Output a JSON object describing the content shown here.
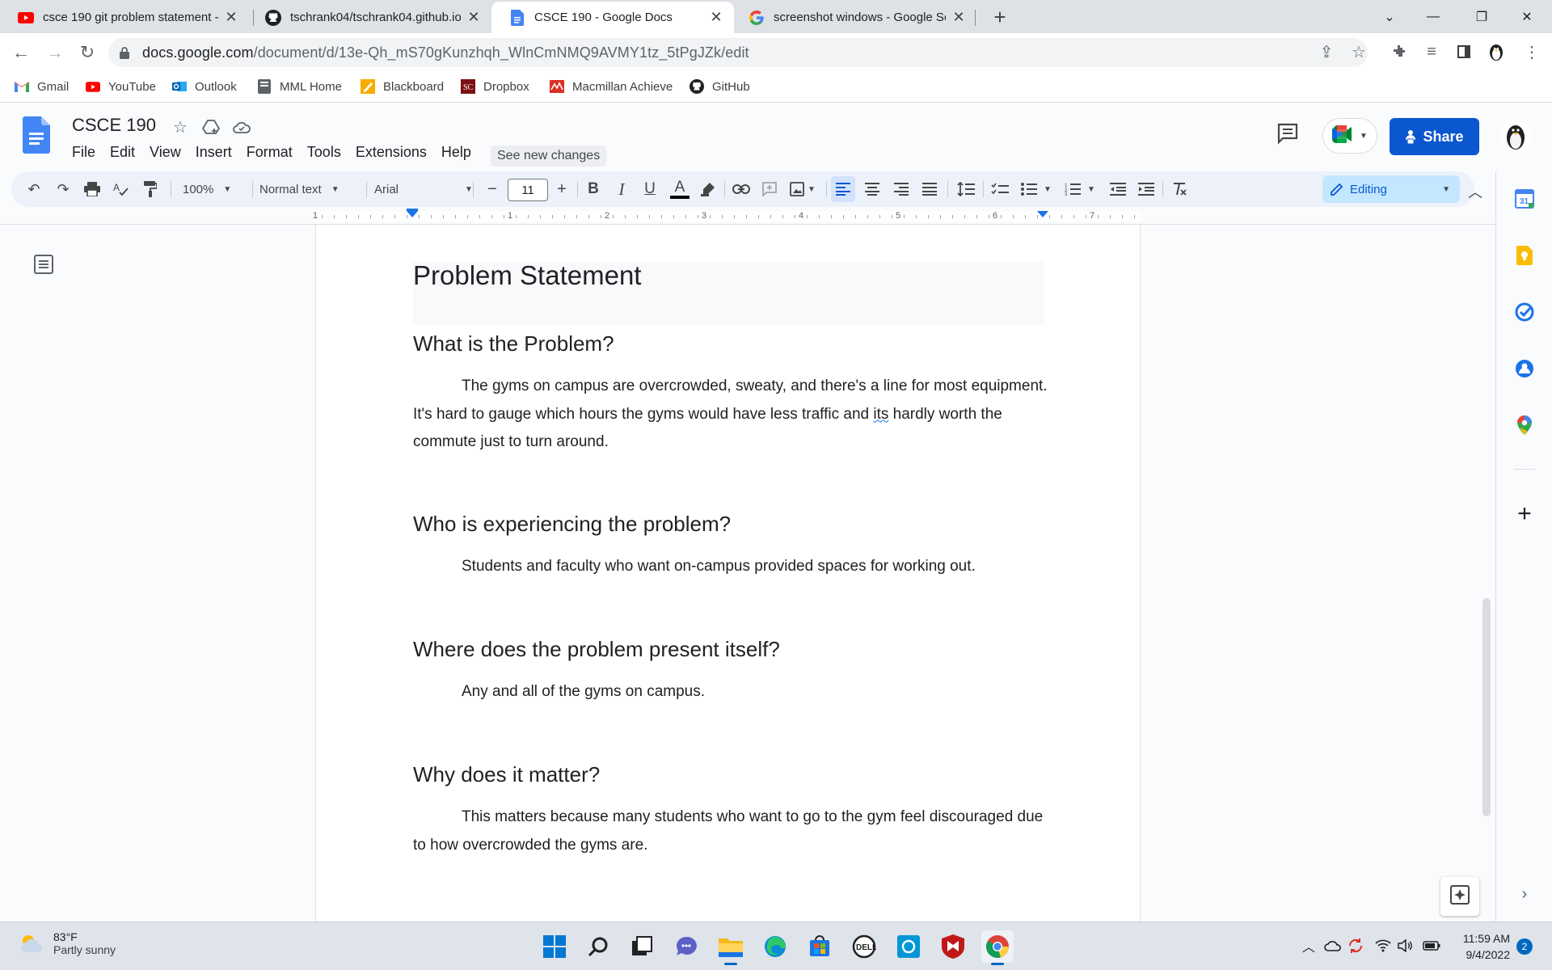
{
  "browser": {
    "tabs": [
      {
        "title": "csce 190 git problem statement -",
        "icon": "youtube-icon",
        "active": false
      },
      {
        "title": "tschrank04/tschrank04.github.io",
        "icon": "github-icon",
        "active": false
      },
      {
        "title": "CSCE 190 - Google Docs",
        "icon": "google-docs-icon",
        "active": true
      },
      {
        "title": "screenshot windows - Google Se",
        "icon": "google-icon",
        "active": false
      }
    ],
    "url_host": "docs.google.com",
    "url_path": "/document/d/13e-Qh_mS70gKunzhqh_WlnCmNMQ9AVMY1tz_5tPgJZk/edit",
    "bookmarks": [
      {
        "label": "Gmail",
        "icon": "gmail-icon"
      },
      {
        "label": "YouTube",
        "icon": "youtube-icon"
      },
      {
        "label": "Outlook",
        "icon": "outlook-icon"
      },
      {
        "label": "MML Home",
        "icon": "mml-icon"
      },
      {
        "label": "Blackboard",
        "icon": "blackboard-icon"
      },
      {
        "label": "Dropbox",
        "icon": "dropbox-icon"
      },
      {
        "label": "Macmillan Achieve",
        "icon": "macmillan-icon"
      },
      {
        "label": "GitHub",
        "icon": "github-icon"
      }
    ]
  },
  "docs": {
    "title": "CSCE 190",
    "menu": [
      "File",
      "Edit",
      "View",
      "Insert",
      "Format",
      "Tools",
      "Extensions",
      "Help"
    ],
    "see_new_changes": "See new changes",
    "share_label": "Share",
    "toolbar": {
      "zoom": "100%",
      "style": "Normal text",
      "font": "Arial",
      "font_size": "11",
      "mode": "Editing"
    },
    "ruler_numbers": [
      "1",
      "1",
      "2",
      "3",
      "4",
      "5",
      "6",
      "7"
    ]
  },
  "document": {
    "title": "Problem Statement",
    "sections": [
      {
        "heading": "What is the Problem?",
        "body_before": "The gyms on campus are overcrowded, sweaty, and there's a line for most equipment. It's hard to gauge which hours the gyms would have less traffic and ",
        "body_flag": "its",
        "body_after": " hardly worth the commute just to turn around."
      },
      {
        "heading": "Who is experiencing the problem?",
        "body": "Students and faculty who want on-campus provided spaces for working out."
      },
      {
        "heading": "Where does the problem present itself?",
        "body": "Any and all of the gyms on campus."
      },
      {
        "heading": "Why does it matter?",
        "body": "This matters because many students who want to go to the gym feel discouraged due to how overcrowded the gyms are."
      }
    ]
  },
  "taskbar": {
    "temperature": "83°F",
    "condition": "Partly sunny",
    "time": "11:59 AM",
    "date": "9/4/2022",
    "notifications": "2"
  },
  "colors": {
    "docs_blue": "#4285f4",
    "share_blue": "#0b57d0",
    "toolbar_bg": "#edf2fa",
    "editing_bg": "#c2e7ff"
  }
}
